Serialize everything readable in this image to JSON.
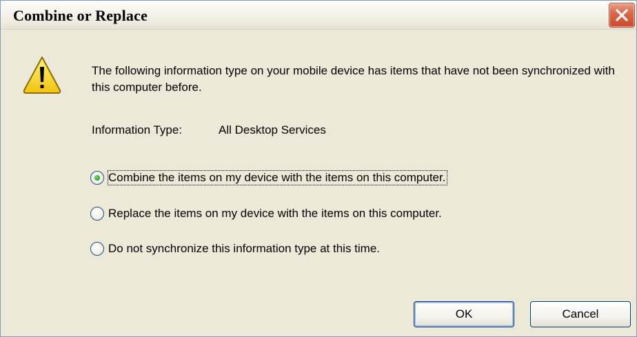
{
  "dialog": {
    "title": "Combine or Replace",
    "message": "The following information type on your mobile device has items that have not been synchronized with this computer before.",
    "info_type_label": "Information Type:",
    "info_type_value": "All Desktop Services",
    "options": [
      {
        "label": "Combine the items on my device with the items on this computer.",
        "selected": true
      },
      {
        "label": "Replace the items on my device with the items on this computer.",
        "selected": false
      },
      {
        "label": "Do not synchronize this information type at this time.",
        "selected": false
      }
    ],
    "ok_label": "OK",
    "cancel_label": "Cancel"
  },
  "icons": {
    "warning": "warning-icon",
    "close": "close-icon"
  },
  "colors": {
    "dialog_background": "#ece9d8",
    "close_button": "#d9694b",
    "radio_selected": "#2eaa2a",
    "warning_yellow": "#f7d21c"
  }
}
